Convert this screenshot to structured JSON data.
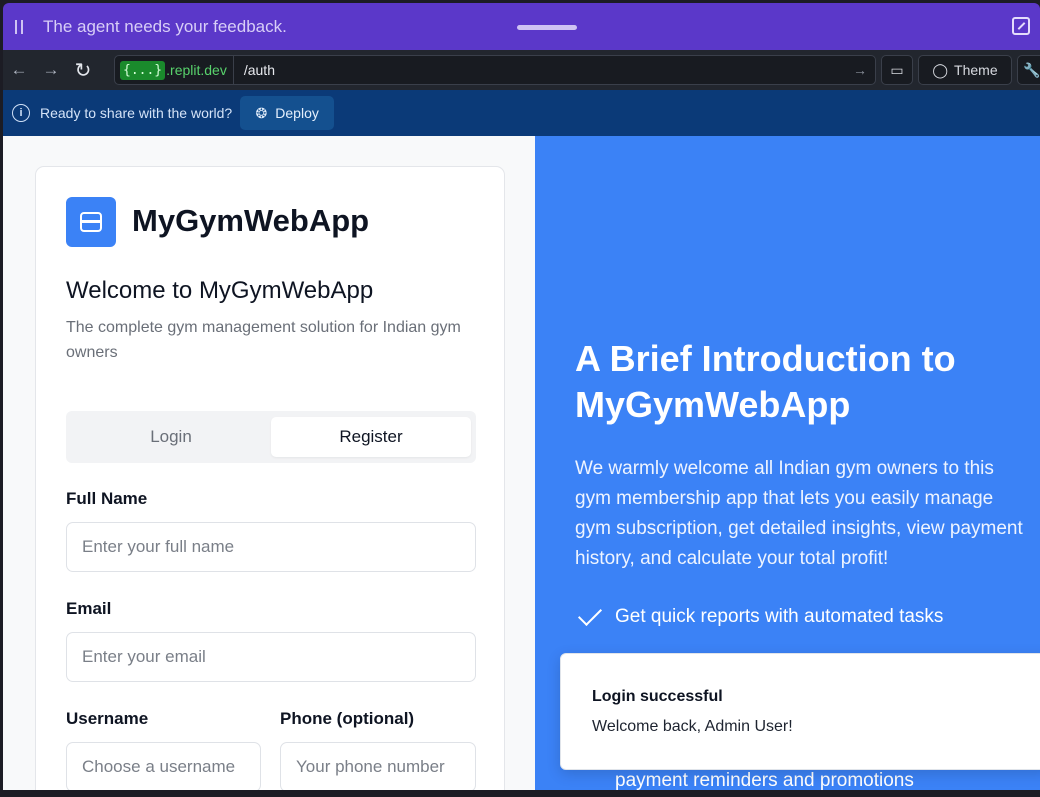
{
  "agent_bar": {
    "message": "The agent needs your feedback."
  },
  "browser": {
    "domain_chip": "{...}",
    "domain_suffix": ".replit.dev",
    "path": "/auth",
    "theme_label": "Theme"
  },
  "deploy_bar": {
    "message": "Ready to share with the world?",
    "deploy_label": "Deploy"
  },
  "auth_card": {
    "app_name": "MyGymWebApp",
    "welcome": "Welcome to MyGymWebApp",
    "subtitle": "The complete gym management solution for Indian gym owners",
    "tabs": [
      {
        "label": "Login",
        "active": false
      },
      {
        "label": "Register",
        "active": true
      }
    ],
    "form": {
      "full_name_label": "Full Name",
      "full_name_placeholder": "Enter your full name",
      "email_label": "Email",
      "email_placeholder": "Enter your email",
      "username_label": "Username",
      "username_placeholder": "Choose a username",
      "phone_label": "Phone (optional)",
      "phone_placeholder": "Your phone number"
    }
  },
  "intro": {
    "title": "A Brief Introduction to MyGymWebApp",
    "text": "We warmly welcome all Indian gym owners to this gym membership app that lets you easily manage gym subscription, get detailed insights, view payment history, and calculate your total profit!",
    "features": [
      "Get quick reports with automated tasks",
      "payment reminders and promotions"
    ]
  },
  "toast": {
    "title": "Login successful",
    "message": "Welcome back, Admin User!"
  },
  "colors": {
    "agent_bar": "#5b38c9",
    "deploy_bar": "#0b3a78",
    "accent": "#3b82f6"
  }
}
